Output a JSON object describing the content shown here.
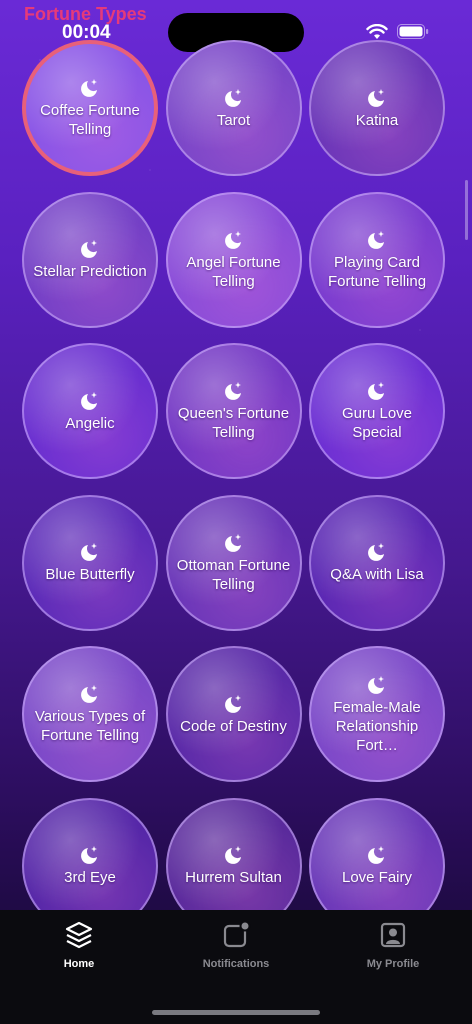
{
  "status": {
    "dev_label": "Fortune Types",
    "time": "00:04"
  },
  "cards": [
    {
      "label": "Coffee Fortune Telling",
      "selected": true,
      "bg": "#8a55e6"
    },
    {
      "label": "Tarot",
      "selected": false,
      "bg": "#7a46c8"
    },
    {
      "label": "Katina",
      "selected": false,
      "bg": "#6b36b8"
    },
    {
      "label": "Stellar Prediction",
      "selected": false,
      "bg": "#7440c6"
    },
    {
      "label": "Angel Fortune Telling",
      "selected": false,
      "bg": "#8a4cd8"
    },
    {
      "label": "Playing Card Fortune Telling",
      "selected": false,
      "bg": "#7a3ccf"
    },
    {
      "label": "Angelic",
      "selected": false,
      "bg": "#6a2fd0"
    },
    {
      "label": "Queen's Fortune Telling",
      "selected": false,
      "bg": "#7438c4"
    },
    {
      "label": "Guru Love Special",
      "selected": false,
      "bg": "#6c2fd3"
    },
    {
      "label": "Blue Butterfly",
      "selected": false,
      "bg": "#5c2bb8"
    },
    {
      "label": "Ottoman Fortune Telling",
      "selected": false,
      "bg": "#6a36b8"
    },
    {
      "label": "Q&A with Lisa",
      "selected": false,
      "bg": "#5a27b3"
    },
    {
      "label": "Various Types of Fortune Telling",
      "selected": false,
      "bg": "#7b49c8"
    },
    {
      "label": "Code of Destiny",
      "selected": false,
      "bg": "#5a2aa8"
    },
    {
      "label": "Female-Male Relationship Fort…",
      "selected": false,
      "bg": "#7b48c8"
    },
    {
      "label": "3rd Eye",
      "selected": false,
      "bg": "#5627a8"
    },
    {
      "label": "Hurrem Sultan",
      "selected": false,
      "bg": "#5a2a9c"
    },
    {
      "label": "Love Fairy",
      "selected": false,
      "bg": "#6a38b8"
    }
  ],
  "tabs": [
    {
      "label": "Home",
      "icon": "layers-icon",
      "active": true
    },
    {
      "label": "Notifications",
      "icon": "notification-icon",
      "active": false
    },
    {
      "label": "My Profile",
      "icon": "profile-icon",
      "active": false
    }
  ],
  "colors": {
    "accent_pink": "#e8607a",
    "dev_label": "#e53a7a",
    "tabbar_bg": "#0b0b0f"
  }
}
